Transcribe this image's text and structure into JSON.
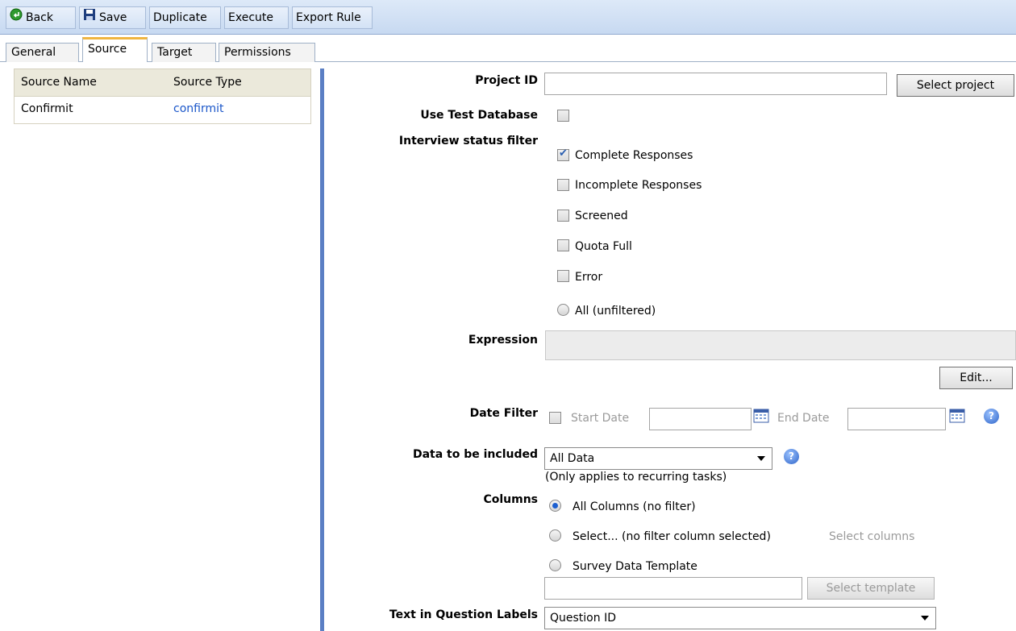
{
  "toolbar": {
    "back_label": "Back",
    "save_label": "Save",
    "duplicate_label": "Duplicate",
    "execute_label": "Execute",
    "export_rule_label": "Export Rule"
  },
  "tabs": [
    {
      "label": "General",
      "active": false
    },
    {
      "label": "Source",
      "active": true
    },
    {
      "label": "Target",
      "active": false
    },
    {
      "label": "Permissions",
      "active": false
    }
  ],
  "sources": {
    "headers": [
      "Source Name",
      "Source Type"
    ],
    "rows": [
      {
        "name": "Confirmit",
        "type": "confirmit"
      }
    ]
  },
  "form": {
    "project_id_label": "Project ID",
    "project_id_value": "",
    "select_project_label": "Select project",
    "use_test_db_label": "Use Test Database",
    "use_test_db_checked": false,
    "interview_status_label": "Interview status filter",
    "status_options": [
      {
        "label": "Complete Responses",
        "checked": true
      },
      {
        "label": "Incomplete Responses",
        "checked": false
      },
      {
        "label": "Screened",
        "checked": false
      },
      {
        "label": "Quota Full",
        "checked": false
      },
      {
        "label": "Error",
        "checked": false
      }
    ],
    "all_unfiltered_label": "All (unfiltered)",
    "expression_label": "Expression",
    "expression_value": "",
    "edit_label": "Edit...",
    "date_filter_label": "Date Filter",
    "start_date_label": "Start Date",
    "start_date_value": "",
    "end_date_label": "End Date",
    "end_date_value": "",
    "data_included_label": "Data to be included",
    "data_included_value": "All Data",
    "data_included_note": "(Only applies to recurring tasks)",
    "columns_label": "Columns",
    "columns_all_label": "All Columns (no filter)",
    "columns_select_label": "Select... (no filter column selected)",
    "select_columns_link": "Select columns",
    "survey_template_label": "Survey Data Template",
    "template_value": "",
    "select_template_label": "Select template",
    "question_labels_label": "Text in Question Labels",
    "question_labels_value": "Question ID"
  },
  "colors": {
    "accent_divider": "#5b7fc4",
    "link": "#1a56c9",
    "active_tab_border": "#f0b540"
  }
}
